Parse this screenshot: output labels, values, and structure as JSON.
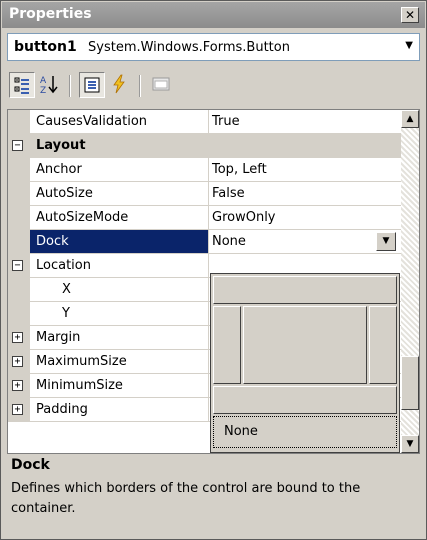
{
  "window": {
    "title": "Properties",
    "close_glyph": "✕"
  },
  "object_selector": {
    "name": "button1",
    "type": "System.Windows.Forms.Button"
  },
  "toolbar": {
    "buttons": [
      {
        "icon": "categorized-icon",
        "pressed": true
      },
      {
        "icon": "alphabetical-sort-icon",
        "pressed": false
      },
      {
        "icon": "properties-icon",
        "pressed": true
      },
      {
        "icon": "events-lightning-icon",
        "pressed": false
      },
      {
        "icon": "property-pages-icon",
        "pressed": false
      }
    ]
  },
  "grid": {
    "rows": [
      {
        "kind": "property",
        "name": "CausesValidation",
        "value": "True"
      },
      {
        "kind": "category",
        "name": "Layout",
        "expander": "−"
      },
      {
        "kind": "property",
        "name": "Anchor",
        "value": "Top, Left"
      },
      {
        "kind": "property",
        "name": "AutoSize",
        "value": "False"
      },
      {
        "kind": "property",
        "name": "AutoSizeMode",
        "value": "GrowOnly"
      },
      {
        "kind": "property",
        "name": "Dock",
        "value": "None",
        "selected": true
      },
      {
        "kind": "expandable",
        "name": "Location",
        "expander": "−"
      },
      {
        "kind": "subproperty",
        "name": "X"
      },
      {
        "kind": "subproperty",
        "name": "Y"
      },
      {
        "kind": "expandable",
        "name": "Margin",
        "expander": "+"
      },
      {
        "kind": "expandable",
        "name": "MaximumSize",
        "expander": "+"
      },
      {
        "kind": "expandable",
        "name": "MinimumSize",
        "expander": "+"
      },
      {
        "kind": "expandable",
        "name": "Padding",
        "expander": "+"
      }
    ]
  },
  "dock_picker": {
    "none_label": "None"
  },
  "description": {
    "title": "Dock",
    "text": "Defines which borders of the control are bound to the container."
  },
  "colors": {
    "selection": "#0a246a",
    "face": "#d4d0c8",
    "title_bar": "#8c8c8c"
  }
}
